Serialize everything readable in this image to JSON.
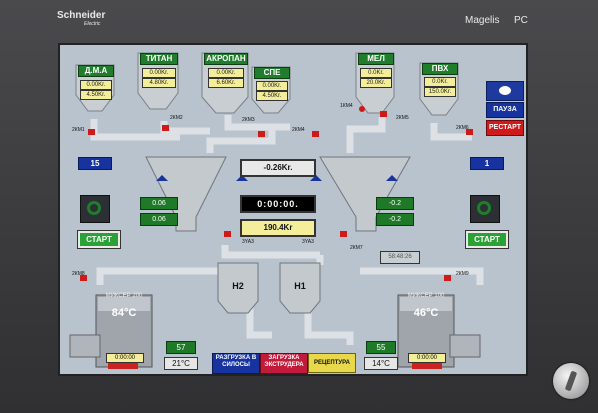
{
  "bezel": {
    "brand": "Schneider",
    "brand_sub": "Electric",
    "product": "Magelis",
    "product_suffix": "PC"
  },
  "silos": [
    {
      "name": "Д.М.А",
      "weight": "0.00Kr.",
      "weight2": "4.50Kr."
    },
    {
      "name": "ТИТАН",
      "weight": "0.00Kr.",
      "weight2": "4.80Kr."
    },
    {
      "name": "АКРОПАН",
      "weight": "0.00Kr.",
      "weight2": "6.60Kr."
    },
    {
      "name": "СПЕ",
      "weight": "0.00Kr.",
      "weight2": "4.50Kr."
    },
    {
      "name": "МЕЛ",
      "weight": "0.0Kr.",
      "weight2": "20.0Kr."
    },
    {
      "name": "ПВХ",
      "weight": "0.0Kr.",
      "weight2": "150.0Kr."
    }
  ],
  "valves": {
    "v1": "2КМ1",
    "v2": "2КМ2",
    "v3": "2КМ3",
    "v4": "2КМ4",
    "v5": "2КМ5",
    "v6": "1КМ4",
    "v7": "2КМ6",
    "v8": "2КМ8",
    "v9": "2КМ7",
    "v10": "3YA3",
    "v11": "3YA3",
    "v12": "2КМ9"
  },
  "counters": {
    "left": "15",
    "right": "1"
  },
  "left_ctrl": {
    "a": "0.06",
    "b": "0.06",
    "start": "СТАРТ"
  },
  "right_ctrl": {
    "a": "-0.2",
    "b": "-0.2",
    "start": "СТАРТ"
  },
  "center": {
    "top_weight": "-0.26Kr.",
    "timer": "0:00:00.",
    "bottom_weight": "190.4Kr",
    "time_small": "58:48:26"
  },
  "side": {
    "pause": "ПАУЗА",
    "restart": "РЕСТАРТ"
  },
  "hoppers": {
    "h2": "Н2",
    "h1": "Н1"
  },
  "mixers": {
    "left": {
      "label": "МИКСЕР 200",
      "temp": "84°C",
      "count": "57",
      "set_temp": "21°C",
      "time": "0:00:00"
    },
    "right": {
      "label": "МИКСЕР 100",
      "temp": "46°C",
      "count": "55",
      "set_temp": "14°C",
      "time": "0:00:00"
    }
  },
  "bottom_buttons": {
    "unload": "РАЗГРУЗКА В СИЛОСЫ",
    "load": "ЗАГРУЗКА ЭКСТРУДЕРА",
    "recipe": "РЕЦЕПТУРА"
  },
  "colors": {
    "screen": "#b9c3cd",
    "silo": "#c8ccd0",
    "pipe": "#d4d8dc",
    "green": "#1f7d2b",
    "blue": "#1633a0",
    "red": "#d01a1a",
    "yellow": "#f4ee9a"
  }
}
